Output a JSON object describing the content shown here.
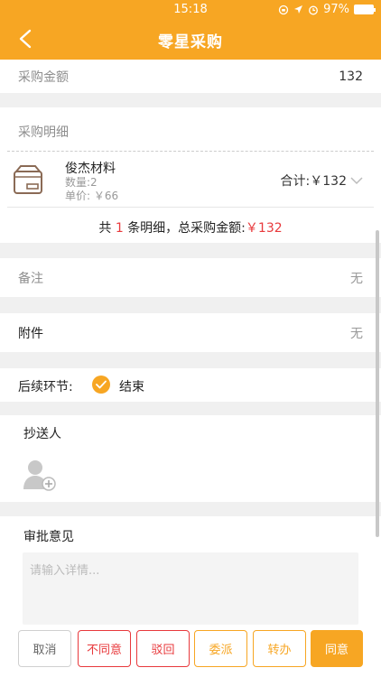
{
  "status_bar": {
    "time": "15:18",
    "battery": "97%"
  },
  "header": {
    "title": "零星采购"
  },
  "amount": {
    "label": "采购金额",
    "value": "132"
  },
  "detail": {
    "label": "采购明细",
    "item": {
      "name": "俊杰材料",
      "qty": "数量:2",
      "price": "单价: ￥66",
      "total": "合计:￥132"
    },
    "summary": {
      "prefix": "共",
      "count": "1",
      "middle": "条明细，总采购金额:",
      "amount": "￥132"
    }
  },
  "remark": {
    "label": "备注",
    "value": "无"
  },
  "attachment": {
    "label": "附件",
    "value": "无"
  },
  "next_step": {
    "label": "后续环节:",
    "option": "结束"
  },
  "cc": {
    "label": "抄送人"
  },
  "opinion": {
    "label": "审批意见",
    "placeholder": "请输入详情..."
  },
  "buttons": {
    "cancel": "取消",
    "disagree": "不同意",
    "reject": "驳回",
    "delegate": "委派",
    "transfer": "转办",
    "agree": "同意"
  },
  "colors": {
    "accent": "#f7a623",
    "danger": "#e8393c"
  }
}
